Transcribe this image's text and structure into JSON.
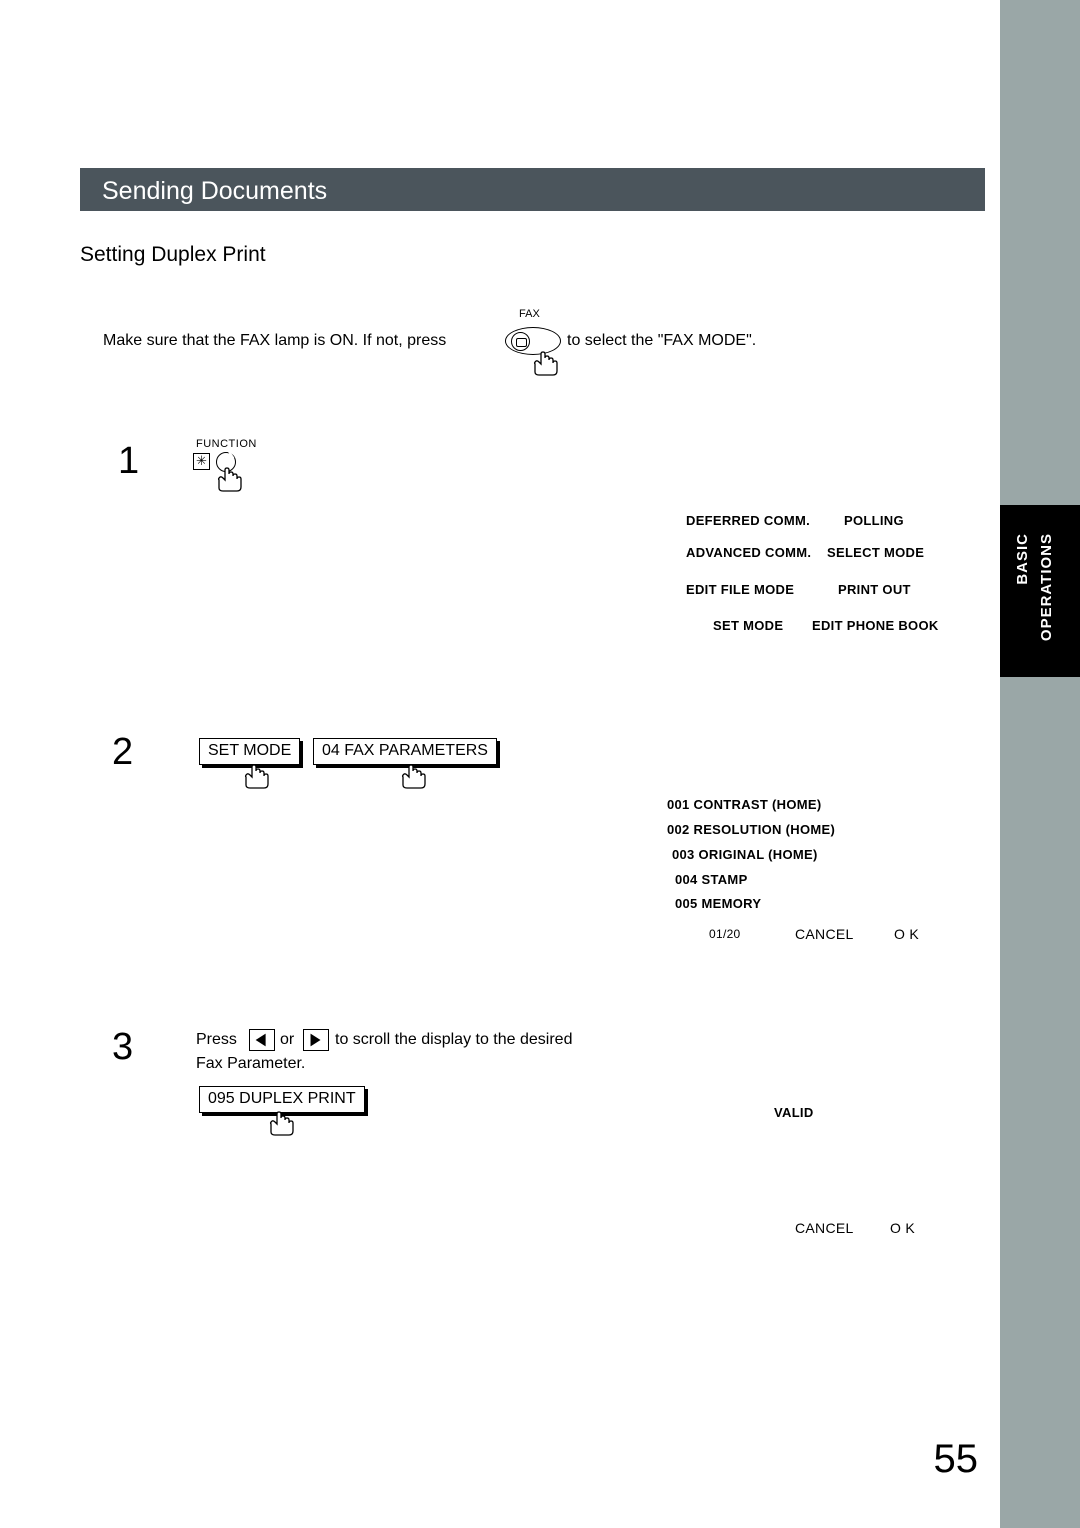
{
  "page": {
    "number": "55",
    "header_title": "Sending Documents",
    "section_title": "Setting Duplex Print",
    "intro_part1": "Make sure that the FAX lamp is ON.  If not, press",
    "intro_part2": "to select the \"FAX MODE\".",
    "fax_key_label": "FAX"
  },
  "side_tab": {
    "line1": "BASIC",
    "line2": "OPERATIONS"
  },
  "steps": [
    {
      "number": "1",
      "key_label": "FUNCTION",
      "asterisk": "✳"
    },
    {
      "number": "2",
      "keys": [
        "SET MODE",
        "04 FAX PARAMETERS"
      ]
    },
    {
      "number": "3",
      "text_line1_a": "Press",
      "text_line1_or": "or",
      "text_line1_b": "to scroll the display to the desired",
      "text_line2": "Fax Parameter.",
      "key": "095 DUPLEX PRINT"
    }
  ],
  "lcd_step1": {
    "rows": [
      [
        "DEFERRED COMM.",
        "POLLING"
      ],
      [
        "ADVANCED COMM.",
        "SELECT MODE"
      ],
      [
        "EDIT FILE MODE",
        "PRINT OUT"
      ],
      [
        "SET MODE",
        "EDIT PHONE BOOK"
      ]
    ]
  },
  "lcd_step2": {
    "items": [
      "001 CONTRAST (HOME)",
      "002 RESOLUTION (HOME)",
      "003 ORIGINAL (HOME)",
      "004 STAMP",
      "005 MEMORY"
    ],
    "page_indicator": "01/20",
    "cancel": "CANCEL",
    "ok": "O K"
  },
  "lcd_step3": {
    "valid": "VALID",
    "cancel": "CANCEL",
    "ok": "O K"
  }
}
